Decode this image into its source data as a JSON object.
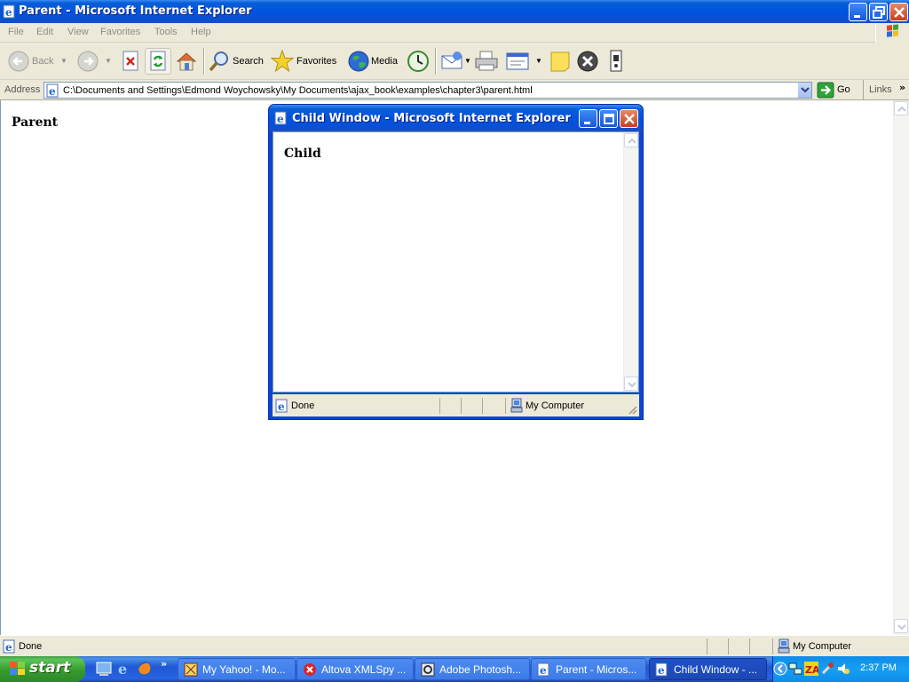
{
  "window": {
    "title": "Parent - Microsoft Internet Explorer",
    "menu": [
      "File",
      "Edit",
      "View",
      "Favorites",
      "Tools",
      "Help"
    ],
    "toolbar": {
      "back_label": "Back",
      "search_label": "Search",
      "favorites_label": "Favorites",
      "media_label": "Media"
    },
    "address": {
      "label": "Address",
      "value": "C:\\Documents and Settings\\Edmond Woychowsky\\My Documents\\ajax_book\\examples\\chapter3\\parent.html",
      "go_label": "Go",
      "links_label": "Links"
    },
    "content": {
      "heading": "Parent"
    },
    "status": {
      "text": "Done",
      "zone": "My Computer"
    }
  },
  "child_window": {
    "title": "Child Window - Microsoft Internet Explorer",
    "content": {
      "heading": "Child"
    },
    "status": {
      "text": "Done",
      "zone": "My Computer"
    }
  },
  "taskbar": {
    "start_label": "start",
    "tasks": [
      {
        "label": "My Yahoo! - Mo...",
        "active": false
      },
      {
        "label": "Altova XMLSpy ...",
        "active": false
      },
      {
        "label": "Adobe Photosh...",
        "active": false
      },
      {
        "label": "Parent - Micros...",
        "active": false
      },
      {
        "label": "Child Window - ...",
        "active": true
      }
    ],
    "clock": "2:37 PM"
  },
  "colors": {
    "xp_title_blue": "#0053e1",
    "xp_face": "#ece9d8",
    "start_green": "#379a2b",
    "close_red": "#c6401e"
  }
}
